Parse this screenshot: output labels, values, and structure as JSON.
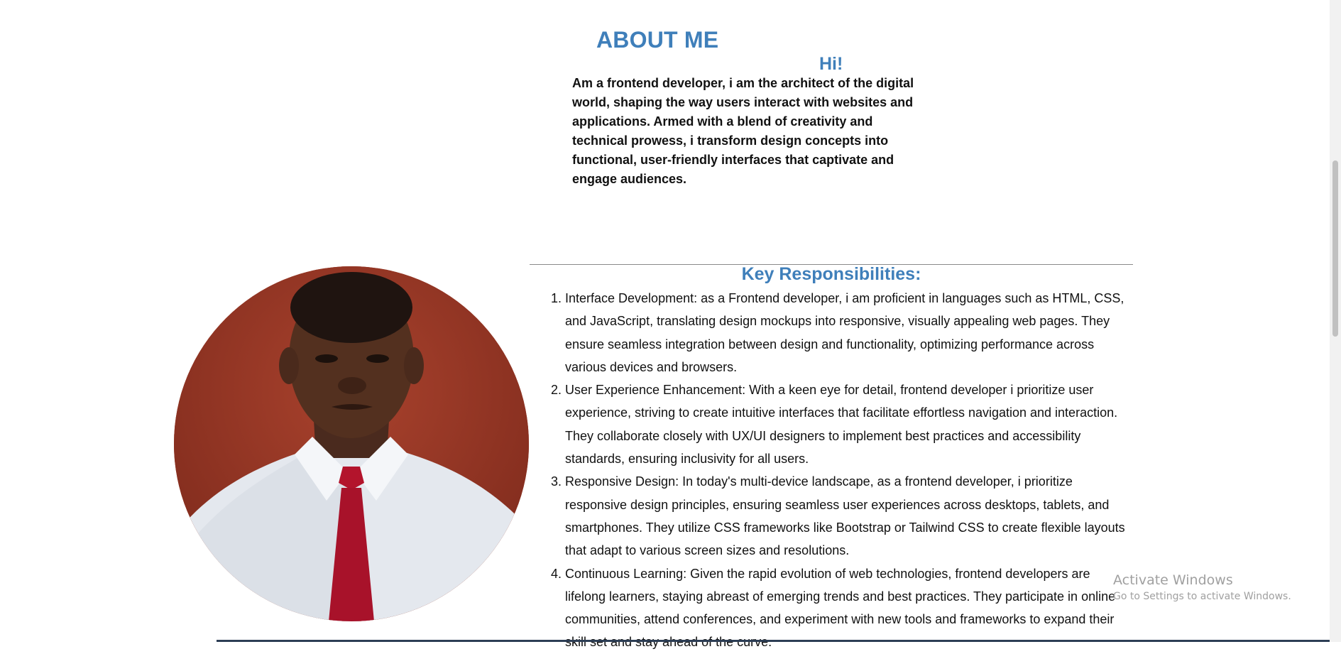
{
  "about": {
    "title": "ABOUT ME",
    "greeting": "Hi!",
    "intro": "Am a frontend developer, i am the architect of the digital world, shaping the way users interact with websites and applications. Armed with a blend of creativity and technical prowess, i transform design concepts into functional, user-friendly interfaces that captivate and engage audiences."
  },
  "responsibilities": {
    "title": "Key Responsibilities:",
    "items": [
      "Interface Development: as a Frontend developer, i am proficient in languages such as HTML, CSS, and JavaScript, translating design mockups into responsive, visually appealing web pages. They ensure seamless integration between design and functionality, optimizing performance across various devices and browsers.",
      "User Experience Enhancement: With a keen eye for detail, frontend developer i prioritize user experience, striving to create intuitive interfaces that facilitate effortless navigation and interaction. They collaborate closely with UX/UI designers to implement best practices and accessibility standards, ensuring inclusivity for all users.",
      "Responsive Design: In today's multi-device landscape, as a frontend developer, i prioritize responsive design principles, ensuring seamless user experiences across desktops, tablets, and smartphones. They utilize CSS frameworks like Bootstrap or Tailwind CSS to create flexible layouts that adapt to various screen sizes and resolutions.",
      "Continuous Learning: Given the rapid evolution of web technologies, frontend developers are lifelong learners, staying abreast of emerging trends and best practices. They participate in online communities, attend conferences, and experiment with new tools and frameworks to expand their skill set and stay ahead of the curve."
    ]
  },
  "watermark": {
    "title": "Activate Windows",
    "subtitle": "Go to Settings to activate Windows."
  },
  "colors": {
    "heading": "#3f7fba",
    "text": "#111111",
    "photo_background": "#9b3826",
    "tie": "#b3142c"
  }
}
